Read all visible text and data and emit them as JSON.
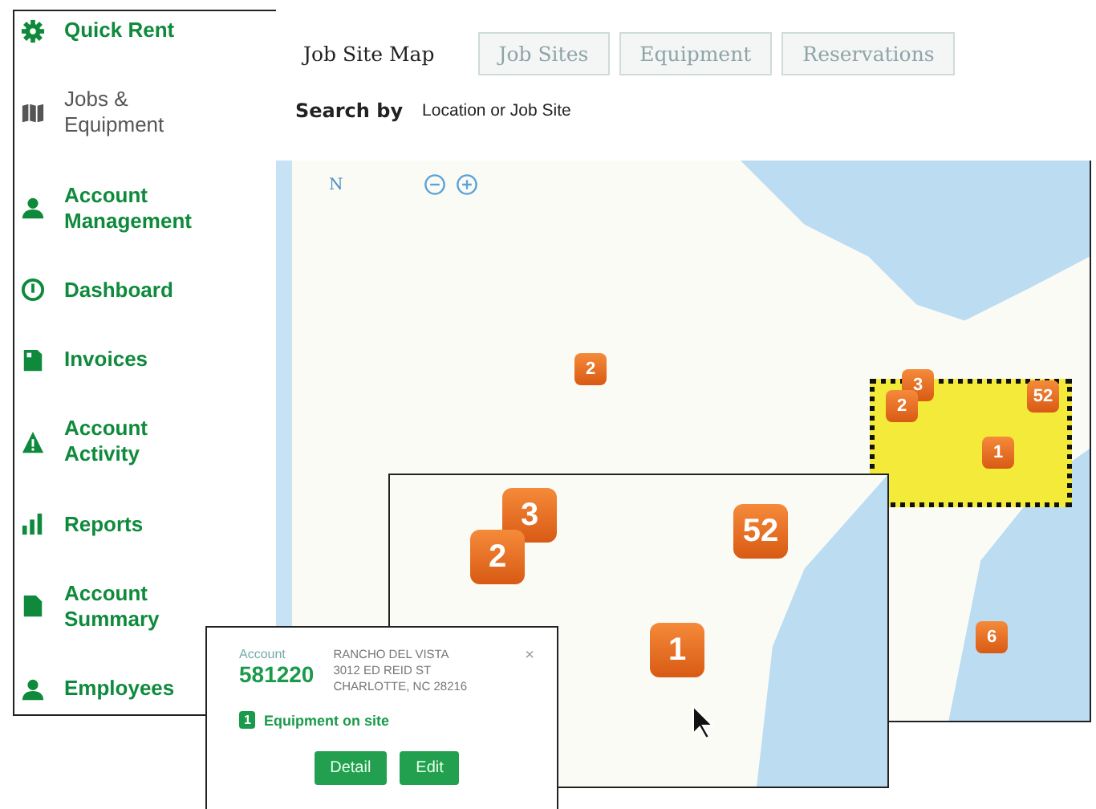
{
  "sidebar": {
    "items": [
      {
        "label": "Quick Rent",
        "selected": false
      },
      {
        "label": "Jobs & Equipment",
        "selected": true
      },
      {
        "label": "Account Management",
        "selected": false
      },
      {
        "label": "Dashboard",
        "selected": false
      },
      {
        "label": "Invoices",
        "selected": false
      },
      {
        "label": "Account Activity",
        "selected": false
      },
      {
        "label": "Reports",
        "selected": false
      },
      {
        "label": "Account Summary",
        "selected": false
      },
      {
        "label": "Employees",
        "selected": false
      }
    ]
  },
  "tabs": [
    {
      "label": "Job Site Map",
      "selected": true
    },
    {
      "label": "Job Sites",
      "selected": false
    },
    {
      "label": "Equipment",
      "selected": false
    },
    {
      "label": "Reservations",
      "selected": false
    }
  ],
  "search": {
    "label": "Search by",
    "placeholder": "Location or Job Site"
  },
  "map": {
    "compass": "N",
    "markers": [
      {
        "count": "2"
      },
      {
        "count": "3"
      },
      {
        "count": "2"
      },
      {
        "count": "52"
      },
      {
        "count": "1"
      },
      {
        "count": "6"
      }
    ]
  },
  "inset_map": {
    "markers": [
      {
        "count": "3"
      },
      {
        "count": "2"
      },
      {
        "count": "52"
      },
      {
        "count": "1"
      }
    ]
  },
  "popup": {
    "account_label": "Account",
    "account_number": "581220",
    "address_lines": [
      "RANCHO DEL VISTA",
      "3012 ED REID ST",
      "CHARLOTTE, NC 28216"
    ],
    "close": "×",
    "equipment_count": "1",
    "equipment_label": "Equipment on site",
    "buttons": [
      "Detail",
      "Edit"
    ]
  }
}
